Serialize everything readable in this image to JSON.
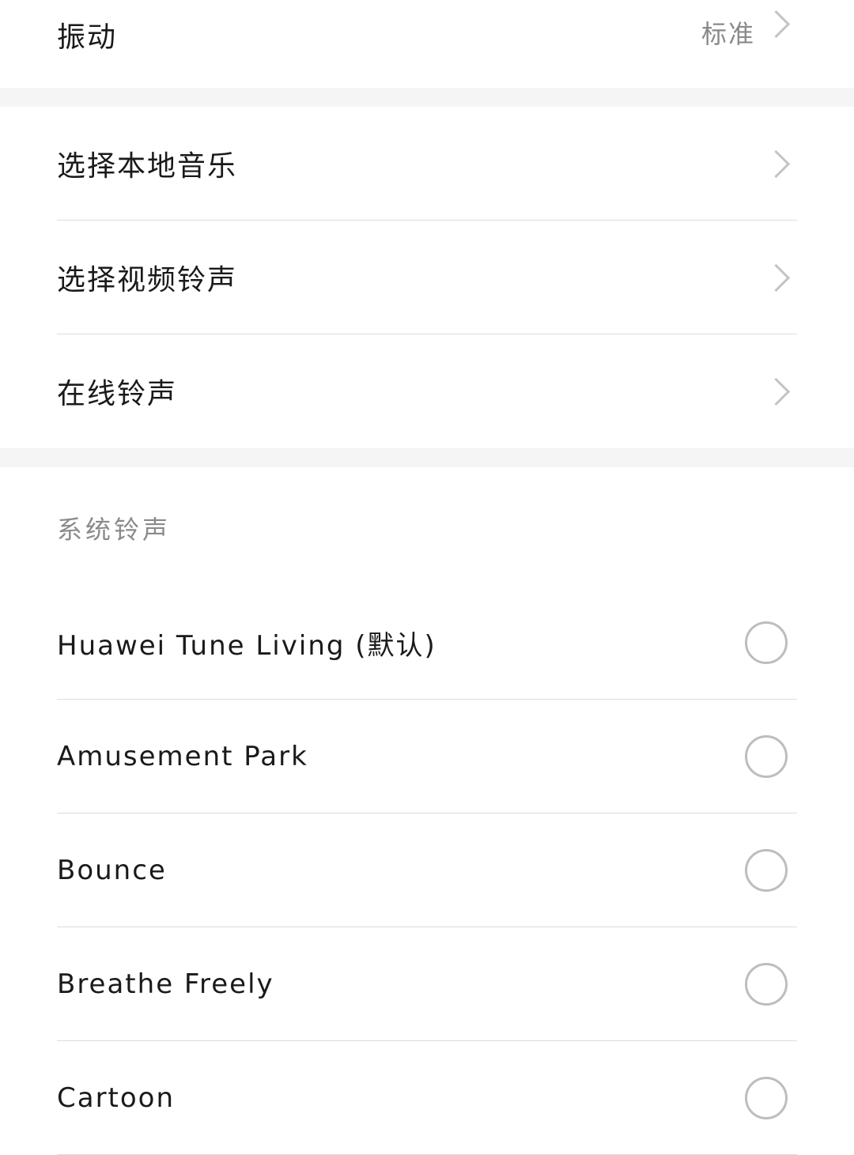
{
  "vibration": {
    "label": "振动",
    "value": "标准"
  },
  "options": [
    {
      "label": "选择本地音乐"
    },
    {
      "label": "选择视频铃声"
    },
    {
      "label": "在线铃声"
    }
  ],
  "system_ringtones": {
    "header": "系统铃声",
    "items": [
      {
        "label": "Huawei Tune Living (默认)"
      },
      {
        "label": "Amusement Park"
      },
      {
        "label": "Bounce"
      },
      {
        "label": "Breathe Freely"
      },
      {
        "label": "Cartoon"
      }
    ]
  }
}
